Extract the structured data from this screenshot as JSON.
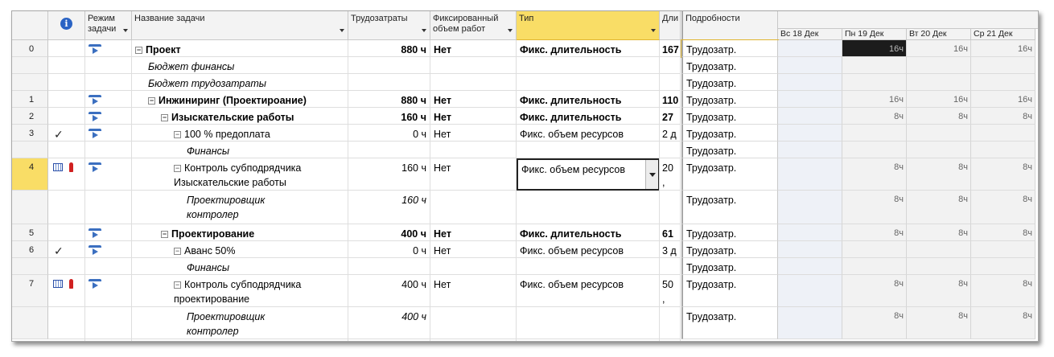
{
  "headers": {
    "info_icon": "i",
    "mode": "Режим задачи",
    "name": "Название задачи",
    "work": "Трудозатраты",
    "fixed": "Фиксированный объем работ",
    "type": "Тип",
    "dur": "Дли",
    "details": "Подробности",
    "days": [
      "Вс 18 Дек",
      "Пн 19 Дек",
      "Вт 20 Дек",
      "Ср 21 Дек"
    ]
  },
  "rows": [
    {
      "num": "0",
      "name": "Проект",
      "work": "880 ч",
      "fixed": "Нет",
      "type": "Фикс. длительность",
      "dur": "167",
      "detail": "Трудозатр.",
      "days": [
        "",
        "16ч",
        "16ч",
        "16ч"
      ],
      "style": "bold",
      "indent": 0,
      "exp": "−",
      "mode_icon": true
    },
    {
      "num": "",
      "name": "Бюджет финансы",
      "work": "",
      "fixed": "",
      "type": "",
      "dur": "",
      "detail": "Трудозатр.",
      "days": [
        "",
        "",
        "",
        ""
      ],
      "style": "ital",
      "indent": 1
    },
    {
      "num": "",
      "name": "Бюджет трудозатраты",
      "work": "",
      "fixed": "",
      "type": "",
      "dur": "",
      "detail": "Трудозатр.",
      "days": [
        "",
        "",
        "",
        ""
      ],
      "style": "ital",
      "indent": 1
    },
    {
      "num": "1",
      "name": "Инжиниринг (Проектироание)",
      "work": "880 ч",
      "fixed": "Нет",
      "type": "Фикс. длительность",
      "dur": "110",
      "detail": "Трудозатр.",
      "days": [
        "",
        "16ч",
        "16ч",
        "16ч"
      ],
      "style": "bold",
      "indent": 1,
      "exp": "−",
      "mode_icon": true
    },
    {
      "num": "2",
      "name": "Изыскательские работы",
      "work": "160 ч",
      "fixed": "Нет",
      "type": "Фикс. длительность",
      "dur": "27 ,",
      "detail": "Трудозатр.",
      "days": [
        "",
        "8ч",
        "8ч",
        "8ч"
      ],
      "style": "bold",
      "indent": 2,
      "exp": "−",
      "mode_icon": true
    },
    {
      "num": "3",
      "name": "100 % предоплата",
      "work": "0 ч",
      "fixed": "Нет",
      "type": "Фикс. объем ресурсов",
      "dur": "2 д",
      "detail": "Трудозатр.",
      "days": [
        "",
        "",
        "",
        ""
      ],
      "style": "normal",
      "indent": 3,
      "exp": "−",
      "mode_icon": true,
      "check": true
    },
    {
      "num": "",
      "name": "Финансы",
      "work": "",
      "fixed": "",
      "type": "",
      "dur": "",
      "detail": "Трудозатр.",
      "days": [
        "",
        "",
        "",
        ""
      ],
      "style": "ital",
      "indent": 4
    },
    {
      "num": "4",
      "name": "Контроль субподрядчика",
      "name2": "Изыскательские работы",
      "work": "160 ч",
      "fixed": "Нет",
      "type": "Фикс. объем ресурсов",
      "dur": "20 ,",
      "detail": "Трудозатр.",
      "days": [
        "",
        "8ч",
        "8ч",
        "8ч"
      ],
      "style": "normal",
      "indent": 3,
      "exp": "−",
      "mode_icon": true,
      "cal": true,
      "sel": true
    },
    {
      "num": "",
      "name": "Проектировщик",
      "name2": "контролер",
      "work": "160 ч",
      "fixed": "",
      "type": "",
      "dur": "",
      "detail": "Трудозатр.",
      "days": [
        "",
        "8ч",
        "8ч",
        "8ч"
      ],
      "style": "ital",
      "indent": 4
    },
    {
      "num": "5",
      "name": "Проектирование",
      "work": "400 ч",
      "fixed": "Нет",
      "type": "Фикс. длительность",
      "dur": "61 ,",
      "detail": "Трудозатр.",
      "days": [
        "",
        "8ч",
        "8ч",
        "8ч"
      ],
      "style": "bold",
      "indent": 2,
      "exp": "−",
      "mode_icon": true
    },
    {
      "num": "6",
      "name": "Аванс 50%",
      "work": "0 ч",
      "fixed": "Нет",
      "type": "Фикс. объем ресурсов",
      "dur": "3 д",
      "detail": "Трудозатр.",
      "days": [
        "",
        "",
        "",
        ""
      ],
      "style": "normal",
      "indent": 3,
      "exp": "−",
      "mode_icon": true,
      "check": true
    },
    {
      "num": "",
      "name": "Финансы",
      "work": "",
      "fixed": "",
      "type": "",
      "dur": "",
      "detail": "Трудозатр.",
      "days": [
        "",
        "",
        "",
        ""
      ],
      "style": "ital",
      "indent": 4
    },
    {
      "num": "7",
      "name": "Контроль субподрядчика",
      "name2": "проектирование",
      "work": "400 ч",
      "fixed": "Нет",
      "type": "Фикс. объем ресурсов",
      "dur": "50 ,",
      "detail": "Трудозатр.",
      "days": [
        "",
        "8ч",
        "8ч",
        "8ч"
      ],
      "style": "normal",
      "indent": 3,
      "exp": "−",
      "mode_icon": true,
      "cal": true
    },
    {
      "num": "",
      "name": "Проектировщик",
      "name2": "контролер",
      "work": "400 ч",
      "fixed": "",
      "type": "",
      "dur": "",
      "detail": "Трудозатр.",
      "days": [
        "",
        "8ч",
        "8ч",
        "8ч"
      ],
      "style": "ital",
      "indent": 4
    }
  ],
  "colors": {
    "selected": "#f9dd66",
    "header_bg": "#f3f3f3",
    "weekend_bg": "#eef1f7",
    "highlight_cell": "#1c1c1c"
  }
}
